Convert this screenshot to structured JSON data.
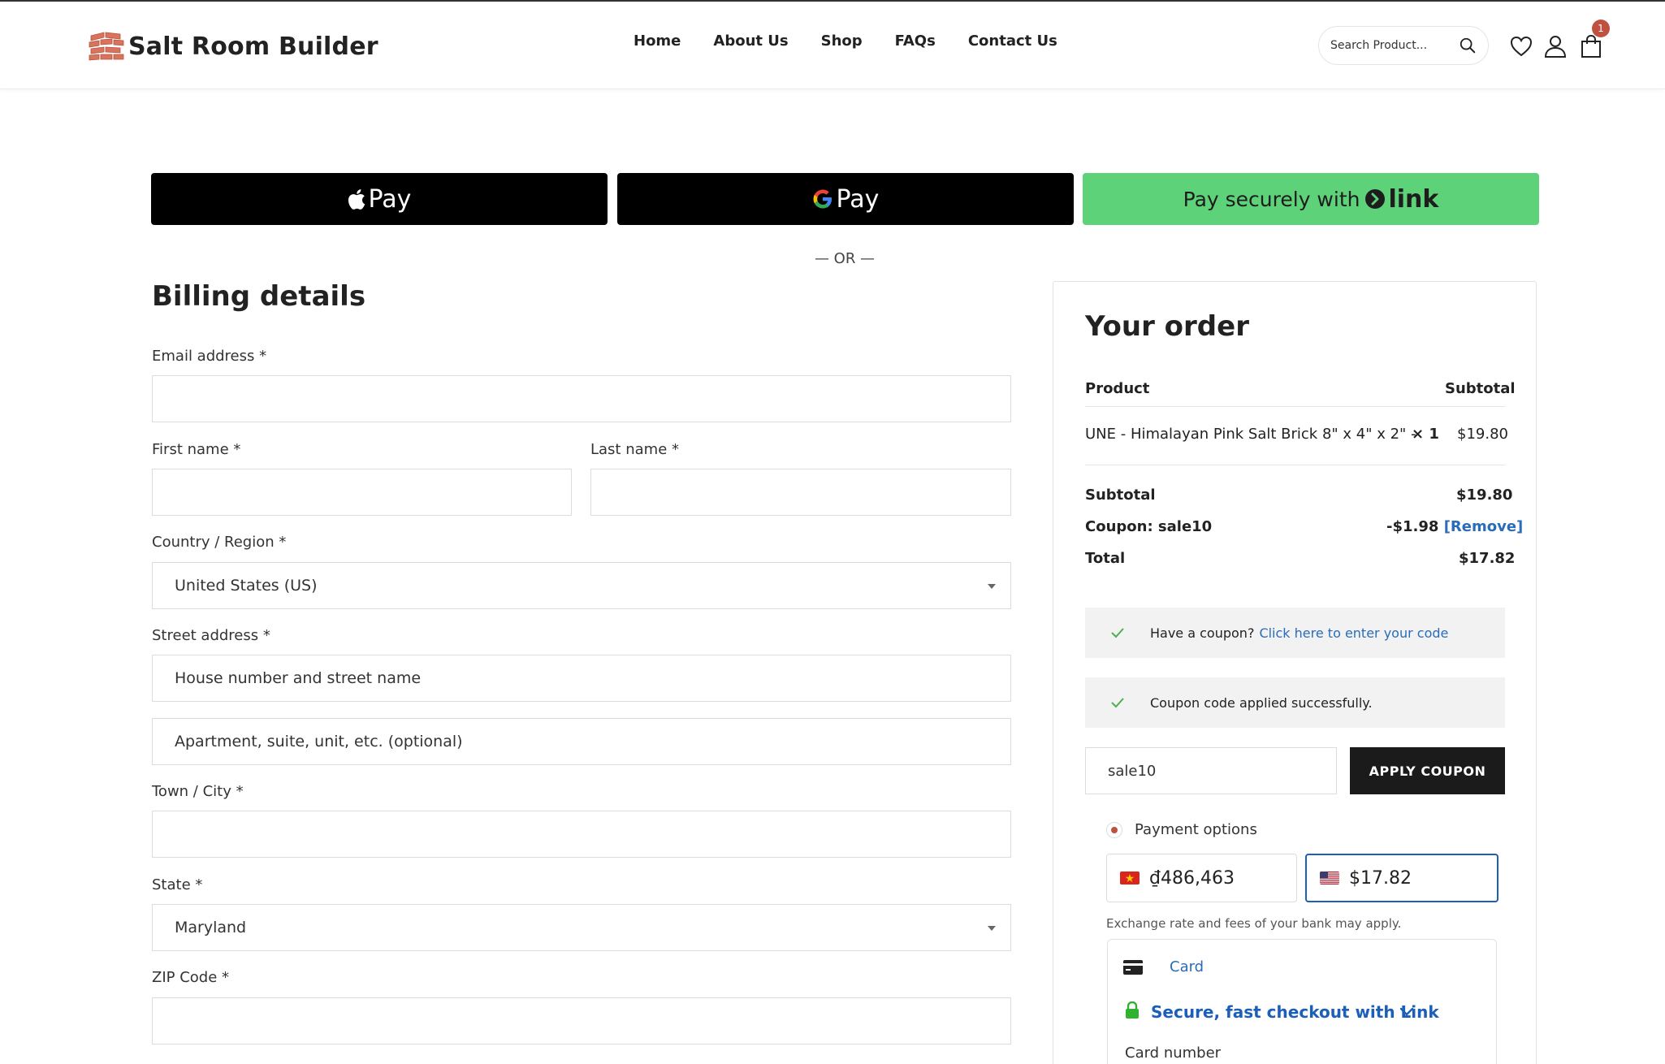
{
  "header": {
    "brand": "Salt Room Builder",
    "nav": [
      "Home",
      "About Us",
      "Shop",
      "FAQs",
      "Contact Us"
    ],
    "search_placeholder": "Search Product...",
    "cart_count": "1"
  },
  "express": {
    "apple_pay": "Pay",
    "google_pay": "Pay",
    "link_text": "Pay securely with",
    "link_brand": "link",
    "separator": "— OR —"
  },
  "billing": {
    "title": "Billing details",
    "email_label": "Email address *",
    "first_label": "First name *",
    "last_label": "Last name *",
    "country_label": "Country / Region *",
    "country_value": "United States (US)",
    "street_label": "Street address *",
    "street_placeholder": "House number and street name",
    "apt_placeholder": "Apartment, suite, unit, etc. (optional)",
    "city_label": "Town / City *",
    "state_label": "State *",
    "state_value": "Maryland",
    "zip_label": "ZIP Code *"
  },
  "order": {
    "title": "Your order",
    "col_product": "Product",
    "col_subtotal": "Subtotal",
    "item_name": "UNE - Himalayan Pink Salt Brick 8\" x 4\" x 2\" -",
    "item_qty": "× 1",
    "item_price": "$19.80",
    "subtotal_label": "Subtotal",
    "subtotal_value": "$19.80",
    "coupon_label": "Coupon: sale10",
    "coupon_value": "-$1.98",
    "coupon_remove": "[Remove]",
    "total_label": "Total",
    "total_value": "$17.82"
  },
  "coupon": {
    "notice_text": "Have a coupon?",
    "notice_link": "Click here to enter your code",
    "applied_text": "Coupon code applied successfully.",
    "input_value": "sale10",
    "apply_label": "APPLY COUPON"
  },
  "payment": {
    "options_label": "Payment options",
    "vnd_amount": "₫486,463",
    "usd_amount": "$17.82",
    "exchange_note": "Exchange rate and fees of your bank may apply.",
    "card_tab": "Card",
    "link_checkout": "Secure, fast checkout with Link",
    "card_number_label": "Card number"
  },
  "colors": {
    "accent_blue": "#2a6cb8",
    "link_green": "#5ed279",
    "brand_red": "#c0503f"
  }
}
